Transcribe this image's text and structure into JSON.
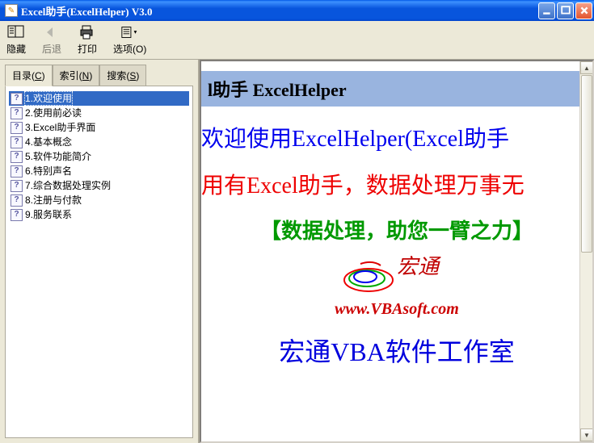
{
  "window": {
    "title": "Excel助手(ExcelHelper) V3.0"
  },
  "toolbar": {
    "hide": "隐藏",
    "back": "后退",
    "print": "打印",
    "options": "选项(O)"
  },
  "tabs": {
    "contents": "目录(C)",
    "index": "索引(N)",
    "search": "搜索(S)"
  },
  "tree": [
    {
      "idx": "1",
      "label": "欢迎使用",
      "selected": true
    },
    {
      "idx": "2",
      "label": "使用前必读",
      "selected": false
    },
    {
      "idx": "3",
      "label": "Excel助手界面",
      "selected": false
    },
    {
      "idx": "4",
      "label": "基本概念",
      "selected": false
    },
    {
      "idx": "5",
      "label": "软件功能简介",
      "selected": false
    },
    {
      "idx": "6",
      "label": "特别声名",
      "selected": false
    },
    {
      "idx": "7",
      "label": "综合数据处理实例",
      "selected": false
    },
    {
      "idx": "8",
      "label": "注册与付款",
      "selected": false
    },
    {
      "idx": "9",
      "label": "服务联系",
      "selected": false
    }
  ],
  "doc": {
    "titlebar": "l助手 ExcelHelper",
    "welcome": "欢迎使用ExcelHelper(Excel助手",
    "slogan": "用有Excel助手，数据处理万事无",
    "tagline": "【数据处理，助您一臂之力】",
    "logo_text": "宏通",
    "url": "www.VBAsoft.com",
    "studio": "宏通VBA软件工作室"
  }
}
